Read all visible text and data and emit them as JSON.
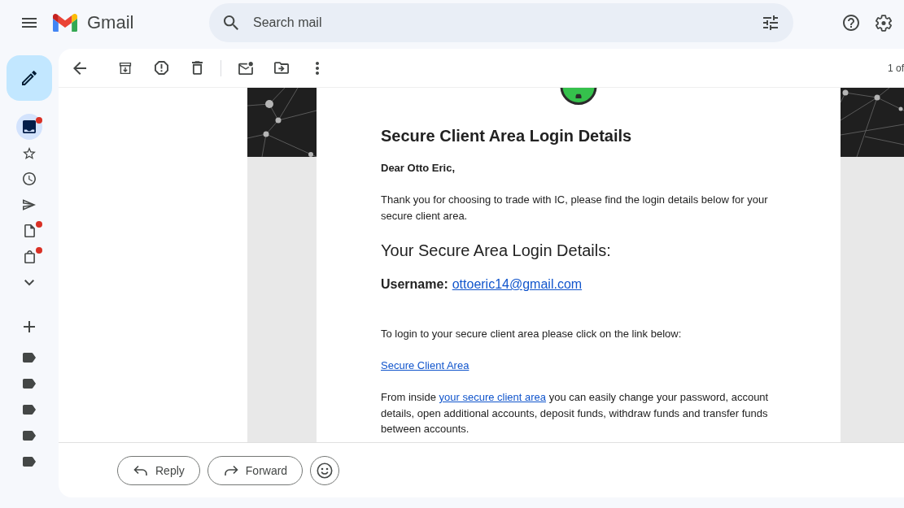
{
  "header": {
    "app_name": "Gmail",
    "search": {
      "placeholder": "Search mail"
    }
  },
  "rail": {
    "items": [
      {
        "selected": true,
        "notification": true
      },
      {
        "selected": false,
        "notification": false
      },
      {
        "selected": false,
        "notification": false
      },
      {
        "selected": false,
        "notification": false
      },
      {
        "selected": false,
        "notification": true
      },
      {
        "selected": false,
        "notification": true
      }
    ]
  },
  "toolbar": {
    "pager": "1 of"
  },
  "email": {
    "heading": "Secure Client Area Login Details",
    "greeting": "Dear Otto Eric,",
    "intro": "Thank you for choosing to trade with IC, please find the login details below for your secure client area.",
    "subheading": "Your Secure Area Login Details:",
    "username": {
      "label": "Username:",
      "value": "ottoeric14@gmail.com"
    },
    "login_prompt": "To login to your secure client area please click on the link below:",
    "login_link": "Secure Client Area",
    "closing": {
      "before": "From inside ",
      "link": "your secure client area",
      "after": " you can easily change your password, account details, open additional accounts, deposit funds, withdraw funds and transfer funds between accounts."
    }
  },
  "actions": [
    {
      "label": "Reply"
    },
    {
      "label": "Forward"
    }
  ]
}
